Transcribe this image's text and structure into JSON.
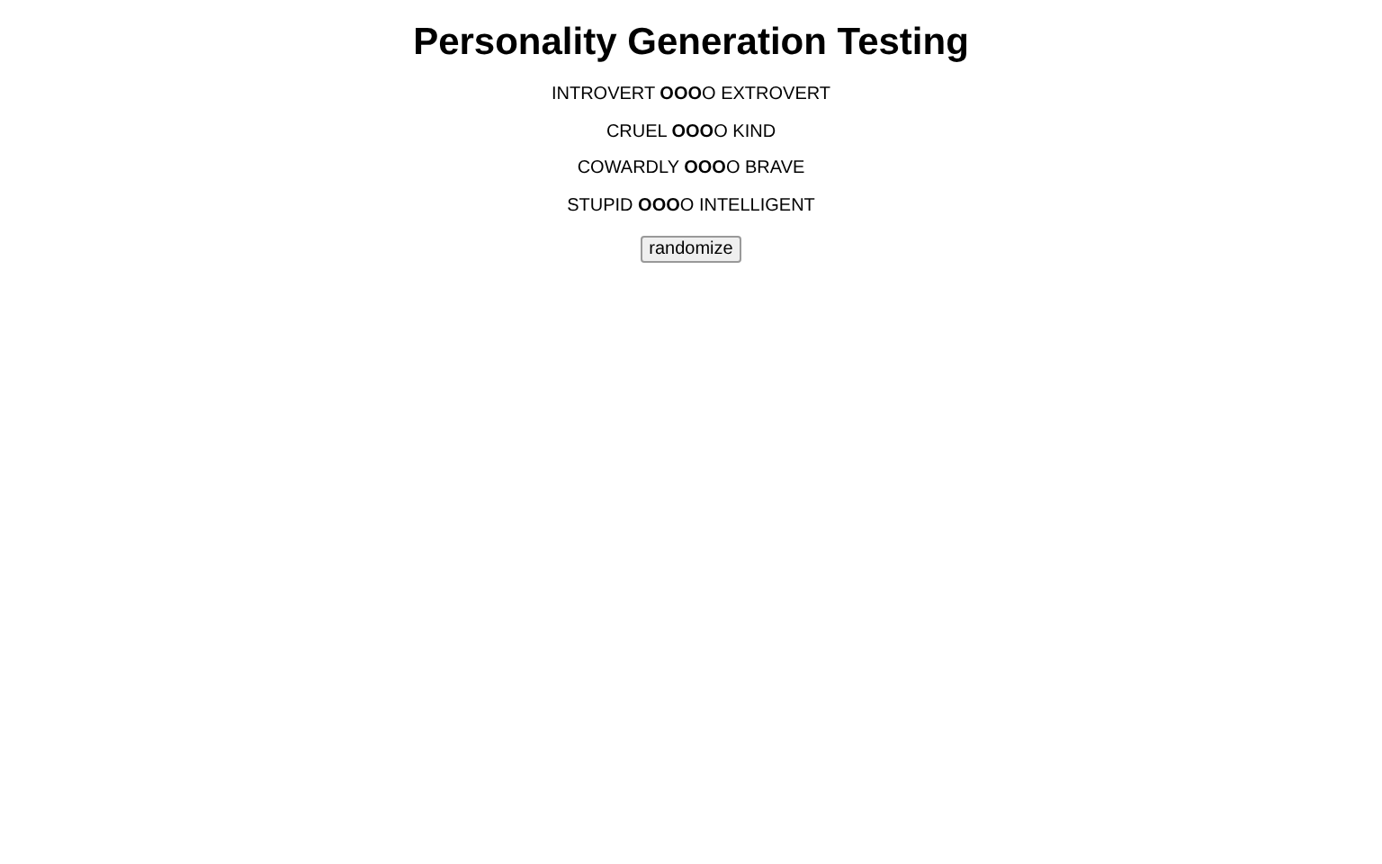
{
  "title": "Personality Generation Testing",
  "traits": [
    {
      "text": "INTROVERT **OOO**O EXTROVERT"
    },
    {
      "text": "CRUEL **OOO**O KIND"
    },
    {
      "text": "COWARDLY **OOO**O BRAVE"
    },
    {
      "text": "STUPID **OOO**O INTELLIGENT"
    }
  ],
  "button": "randomize"
}
